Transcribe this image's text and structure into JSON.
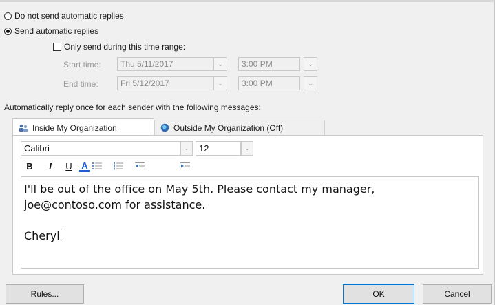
{
  "reply_mode": {
    "off_label": "Do not send automatic replies",
    "on_label": "Send automatic replies",
    "selected": "on"
  },
  "time_range": {
    "checkbox_label": "Only send during this time range:",
    "checked": false,
    "start_label": "Start time:",
    "start_date": "Thu 5/11/2017",
    "start_time": "3:00 PM",
    "end_label": "End time:",
    "end_date": "Fri 5/12/2017",
    "end_time": "3:00 PM"
  },
  "instructions": "Automatically reply once for each sender with the following messages:",
  "tabs": [
    {
      "label": "Inside My Organization",
      "icon": "people-icon",
      "active": true
    },
    {
      "label": "Outside My Organization (Off)",
      "icon": "globe-icon",
      "active": false
    }
  ],
  "formatting": {
    "font_name": "Calibri",
    "font_size": "12",
    "bold": "B",
    "italic": "I",
    "underline": "U",
    "font_color": "A"
  },
  "message": {
    "line1": "I'll be out of the office on May 5th. Please contact my manager,",
    "line2": "joe@contoso.com for assistance.",
    "signature": "Cheryl"
  },
  "buttons": {
    "rules": "Rules...",
    "ok": "OK",
    "cancel": "Cancel"
  },
  "colors": {
    "background": "#f0f0f0",
    "font_color_underline": "#1e5bd8",
    "ok_border": "#0078d7"
  }
}
